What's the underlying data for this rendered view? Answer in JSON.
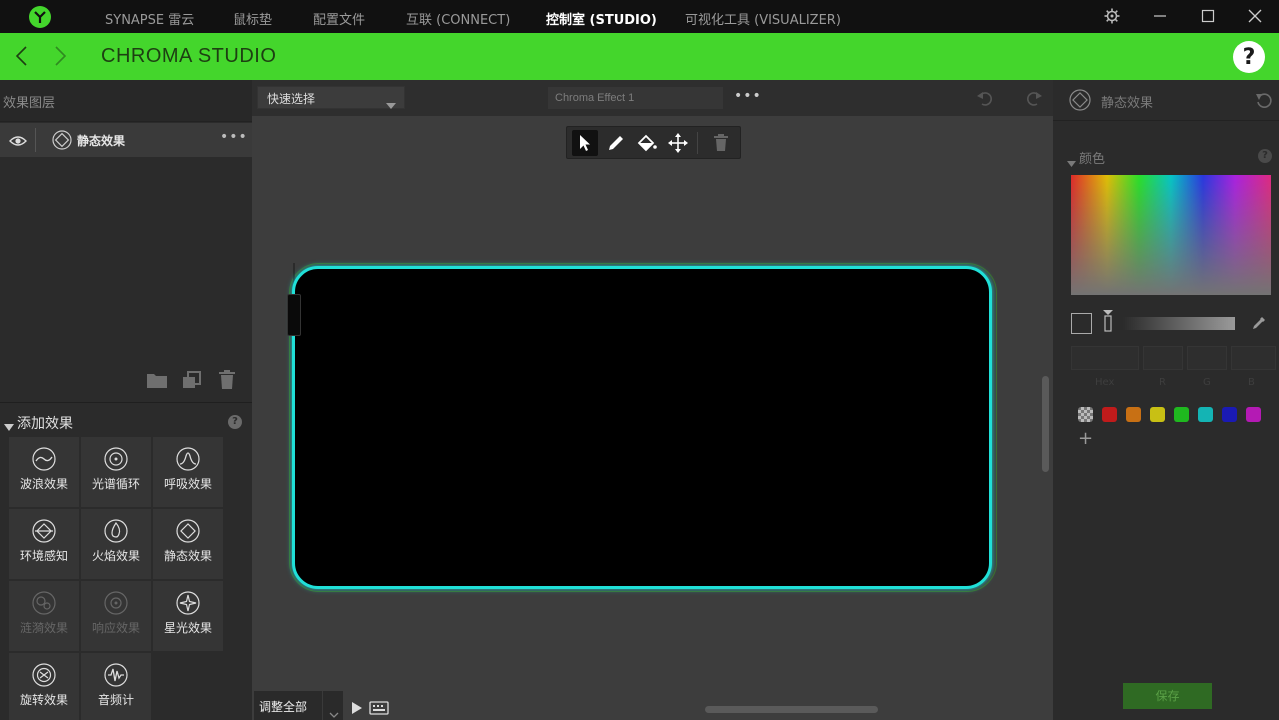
{
  "topbar": {
    "tabs": [
      "SYNAPSE 雷云",
      "鼠标垫",
      "配置文件",
      "互联 (CONNECT)",
      "控制室 (STUDIO)",
      "可视化工具 (VISUALIZER)"
    ],
    "active_tab": "控制室 (STUDIO)"
  },
  "header": {
    "title": "CHROMA STUDIO",
    "help": "?"
  },
  "left": {
    "layers_title": "效果图层",
    "layer": {
      "name": "静态效果",
      "more": "•••"
    },
    "add_effect_title": "添加效果",
    "add_help": "?",
    "effects": [
      {
        "label": "波浪效果",
        "icon": "wave-icon",
        "enabled": true
      },
      {
        "label": "光谱循环",
        "icon": "spectrum-icon",
        "enabled": true
      },
      {
        "label": "呼吸效果",
        "icon": "breathing-icon",
        "enabled": true
      },
      {
        "label": "环境感知",
        "icon": "ambient-icon",
        "enabled": true
      },
      {
        "label": "火焰效果",
        "icon": "fire-icon",
        "enabled": true
      },
      {
        "label": "静态效果",
        "icon": "static-icon",
        "enabled": true
      },
      {
        "label": "涟漪效果",
        "icon": "ripple-icon",
        "enabled": false
      },
      {
        "label": "响应效果",
        "icon": "reactive-icon",
        "enabled": false
      },
      {
        "label": "星光效果",
        "icon": "starlight-icon",
        "enabled": true
      },
      {
        "label": "旋转效果",
        "icon": "spin-icon",
        "enabled": true
      },
      {
        "label": "音频计",
        "icon": "audio-meter-icon",
        "enabled": true
      }
    ]
  },
  "center": {
    "quick_select": "快速选择",
    "effect_name": "Chroma Effect 1",
    "more": "•••",
    "bottom_dropdown": "调整全部"
  },
  "right": {
    "title": "静态效果",
    "color_section": "颜色",
    "color_help": "?",
    "value_labels": [
      "Hex",
      "R",
      "G",
      "B"
    ],
    "presets": [
      "#c8c8c8",
      "#c01b1b",
      "#c87014",
      "#c8c014",
      "#1fb81f",
      "#14b4b4",
      "#1a1ab4",
      "#b41ab4"
    ],
    "save": "保存"
  },
  "colors": {
    "accent": "#44d62c",
    "device_glow": "#20e0d8"
  }
}
